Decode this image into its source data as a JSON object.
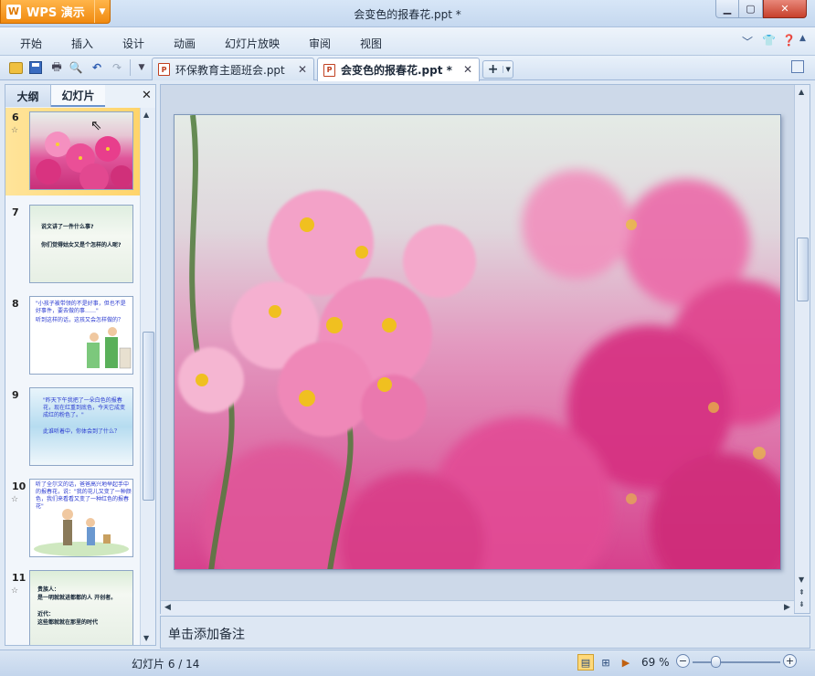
{
  "app": {
    "button_label": "WPS 演示",
    "logo_glyph": "W",
    "window_title": "会变色的报春花.ppt *"
  },
  "menu": [
    "开始",
    "插入",
    "设计",
    "动画",
    "幻灯片放映",
    "审阅",
    "视图"
  ],
  "tabs": [
    {
      "label": "环保教育主题班会.ppt",
      "active": false
    },
    {
      "label": "会变色的报春花.ppt *",
      "active": true
    }
  ],
  "left_pane": {
    "tabs": [
      "大纲",
      "幻灯片"
    ],
    "active_tab": "幻灯片",
    "slides": [
      {
        "number": "6",
        "has_animation": true,
        "selected": true
      },
      {
        "number": "7",
        "has_animation": false,
        "selected": false,
        "lines": [
          "说文讲了一件什么事?",
          "你们觉得姑女又是个怎样的人呢?"
        ]
      },
      {
        "number": "8",
        "has_animation": false,
        "selected": false,
        "lines": [
          "\"小孩子被带领的不是好事，但也不是好事件，要去做的事……\"",
          "听到这样的话，这孩又会怎样做的？"
        ]
      },
      {
        "number": "9",
        "has_animation": false,
        "selected": false,
        "lines": [
          "\"昨天下午我把了一朵白色的报春花，现在红重到底色，今天它成变成红的粉色了。\"",
          "此谁听着中，你体会到了什么？"
        ]
      },
      {
        "number": "10",
        "has_animation": true,
        "selected": false,
        "lines": [
          "听了全尔文的话，爸爸高兴地举起手中的报春花，说：\"我的花儿又变了一种颜色，我们来看看又变了一种红色的报春花\""
        ]
      },
      {
        "number": "11",
        "has_animation": true,
        "selected": false,
        "lines": [
          "贵族人：",
          "是一明就就进都都的人 开创者。",
          "近代：",
          "这些都就就在那里的时代"
        ]
      }
    ]
  },
  "notes_placeholder": "单击添加备注",
  "status": {
    "slide_counter": "幻灯片 6 / 14",
    "zoom": "69 %",
    "zoom_fraction": 0.27
  },
  "colors": {
    "accent_orange": "#f08a10",
    "title_bg": "#c5d8ef",
    "selection": "#ffd46a"
  }
}
